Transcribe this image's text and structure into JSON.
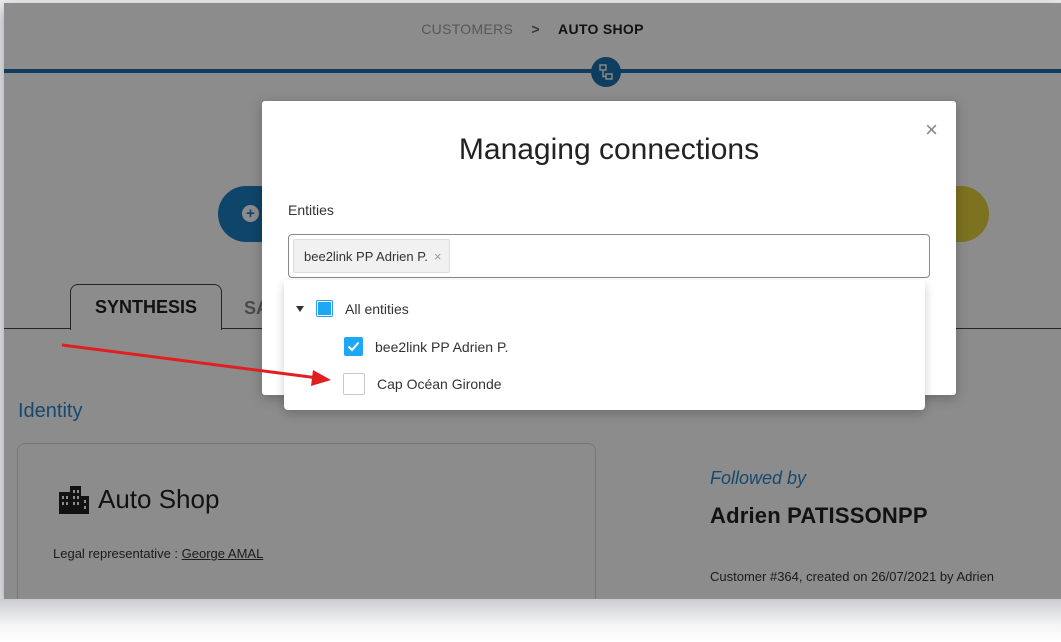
{
  "breadcrumb": {
    "parent": "CUSTOMERS",
    "separator": ">",
    "current": "AUTO SHOP"
  },
  "tabs": [
    {
      "label": "SYNTHESIS",
      "active": true
    },
    {
      "label": "SA",
      "active": false
    }
  ],
  "identity": {
    "section_title": "Identity",
    "company_name": "Auto Shop",
    "legal_rep_label": "Legal representative :",
    "legal_rep_name": "George AMAL"
  },
  "followed": {
    "label": "Followed by",
    "name": "Adrien PATISSONPP",
    "customer_info": "Customer #364, created on 26/07/2021 by Adrien"
  },
  "modal": {
    "title": "Managing connections",
    "close_symbol": "×",
    "entities_label": "Entities",
    "selected_tag": "bee2link PP Adrien P.",
    "tag_remove_symbol": "×"
  },
  "tree": {
    "root_label": "All entities",
    "root_state": "indeterminate",
    "items": [
      {
        "label": "bee2link PP Adrien P.",
        "checked": true
      },
      {
        "label": "Cap Océan Gironde",
        "checked": false
      }
    ]
  },
  "colors": {
    "brand_blue": "#1c6fad",
    "accent_blue": "#1ea7f4",
    "heading_blue": "#2a86c9",
    "yellow_button": "#e4cf3c",
    "annotation_arrow": "#e02020"
  },
  "icons": [
    "connections-icon",
    "plus-icon",
    "building-icon",
    "close-icon",
    "caret-down-icon",
    "checkmark-icon"
  ]
}
